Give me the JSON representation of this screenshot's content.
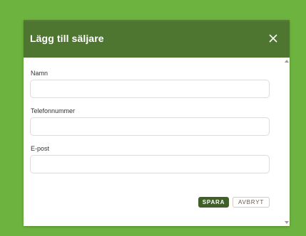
{
  "dialog": {
    "title": "Lägg till säljare",
    "fields": [
      {
        "label": "Namn",
        "value": "",
        "placeholder": ""
      },
      {
        "label": "Telefonnummer",
        "value": "",
        "placeholder": ""
      },
      {
        "label": "E-post",
        "value": "",
        "placeholder": ""
      }
    ],
    "buttons": {
      "save_label": "SPARA",
      "cancel_label": "AVBRYT"
    }
  },
  "colors": {
    "background": "#6db33f",
    "header": "#4f7630",
    "primary_button": "#3f6128"
  },
  "icons": {
    "close": "close-icon",
    "scroll_up": "scroll-up-arrow-icon",
    "scroll_down": "scroll-down-arrow-icon"
  }
}
